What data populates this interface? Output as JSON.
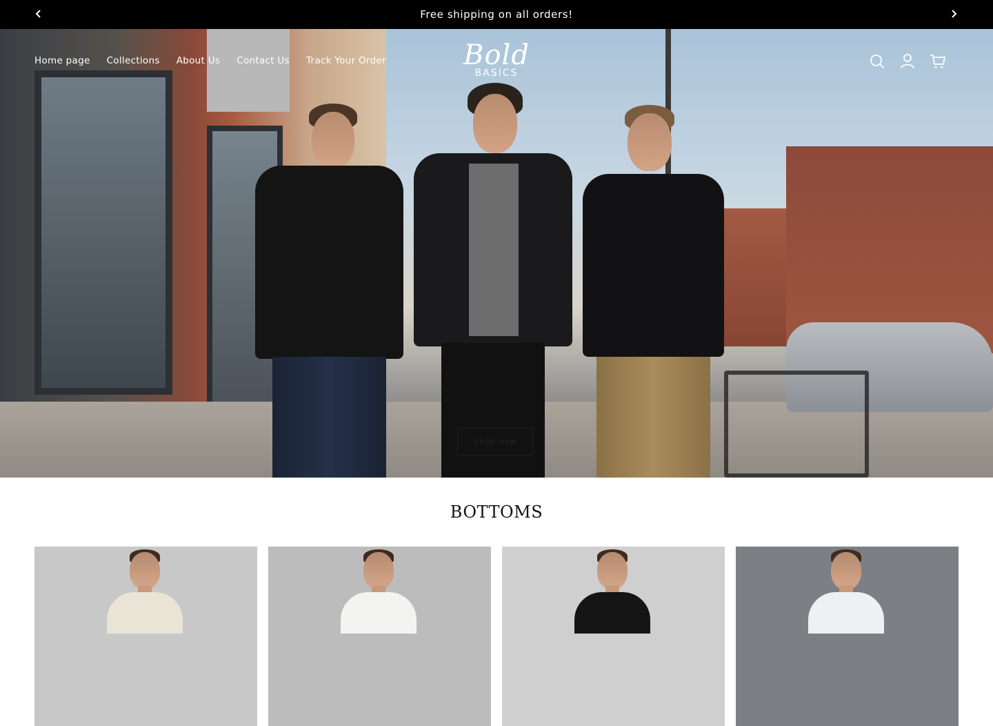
{
  "announcement": {
    "text": "Free shipping on all orders!",
    "prev_icon": "chevron-left-icon",
    "next_icon": "chevron-right-icon"
  },
  "header": {
    "nav": [
      {
        "label": "Home page"
      },
      {
        "label": "Collections"
      },
      {
        "label": "About Us"
      },
      {
        "label": "Contact Us"
      },
      {
        "label": "Track Your Order"
      }
    ],
    "logo": {
      "script": "Bold",
      "sub": "BASICS"
    },
    "icons": [
      "search-icon",
      "account-icon",
      "cart-icon"
    ]
  },
  "hero": {
    "button_label": "Shop now"
  },
  "collection": {
    "title": "BOTTOMS",
    "products": [
      {
        "shirt_color": "#e9e4d6",
        "bg": "#c8c8c8"
      },
      {
        "shirt_color": "#f3f3f1",
        "bg": "#bcbcbc"
      },
      {
        "shirt_color": "#151515",
        "bg": "#cfcfcf"
      },
      {
        "shirt_color": "#eef1f4",
        "bg": "#7d7f84"
      }
    ]
  },
  "colors": {
    "announcement_bg": "#000000",
    "text_primary": "#121212",
    "header_text": "#ffffff"
  }
}
